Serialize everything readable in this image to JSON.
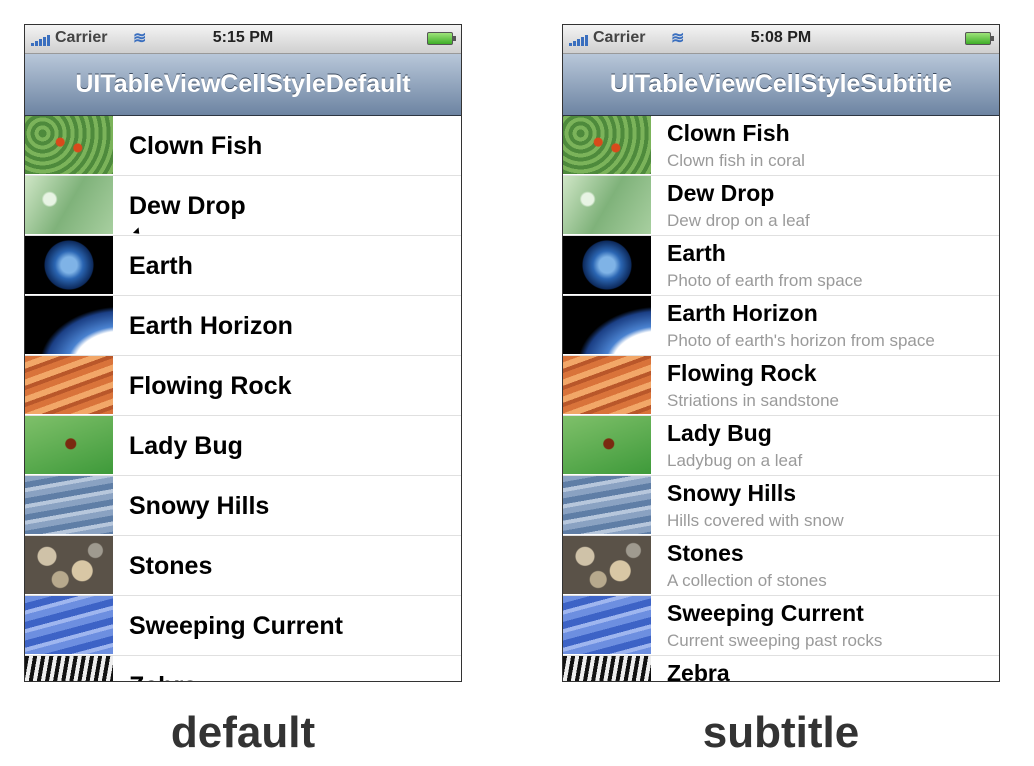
{
  "phones": {
    "default": {
      "status": {
        "carrier": "Carrier",
        "time": "5:15 PM"
      },
      "nav_title": "UITableViewCellStyleDefault",
      "rows": [
        {
          "title": "Clown Fish",
          "image": "clown-fish"
        },
        {
          "title": "Dew Drop",
          "image": "dew-drop"
        },
        {
          "title": "Earth",
          "image": "earth"
        },
        {
          "title": "Earth Horizon",
          "image": "earth-horizon"
        },
        {
          "title": "Flowing Rock",
          "image": "flowing-rock"
        },
        {
          "title": "Lady Bug",
          "image": "lady-bug"
        },
        {
          "title": "Snowy Hills",
          "image": "snowy-hills"
        },
        {
          "title": "Stones",
          "image": "stones"
        },
        {
          "title": "Sweeping Current",
          "image": "sweeping-current"
        },
        {
          "title": "Zebra",
          "image": "zebra"
        }
      ]
    },
    "subtitle": {
      "status": {
        "carrier": "Carrier",
        "time": "5:08 PM"
      },
      "nav_title": "UITableViewCellStyleSubtitle",
      "rows": [
        {
          "title": "Clown Fish",
          "subtitle": "Clown fish in coral",
          "image": "clown-fish"
        },
        {
          "title": "Dew Drop",
          "subtitle": "Dew drop on a leaf",
          "image": "dew-drop"
        },
        {
          "title": "Earth",
          "subtitle": "Photo of earth from space",
          "image": "earth"
        },
        {
          "title": "Earth Horizon",
          "subtitle": "Photo of earth's horizon from space",
          "image": "earth-horizon"
        },
        {
          "title": "Flowing Rock",
          "subtitle": "Striations in sandstone",
          "image": "flowing-rock"
        },
        {
          "title": "Lady Bug",
          "subtitle": "Ladybug on a leaf",
          "image": "lady-bug"
        },
        {
          "title": "Snowy Hills",
          "subtitle": "Hills covered with snow",
          "image": "snowy-hills"
        },
        {
          "title": "Stones",
          "subtitle": "A collection of stones",
          "image": "stones"
        },
        {
          "title": "Sweeping Current",
          "subtitle": "Current sweeping past rocks",
          "image": "sweeping-current"
        },
        {
          "title": "Zebra",
          "subtitle": "",
          "image": "zebra"
        }
      ]
    }
  },
  "captions": {
    "default": "default",
    "subtitle": "subtitle"
  },
  "colors": {
    "nav_bar": "#6d84a2",
    "subtitle_text": "#9a9a9a"
  }
}
